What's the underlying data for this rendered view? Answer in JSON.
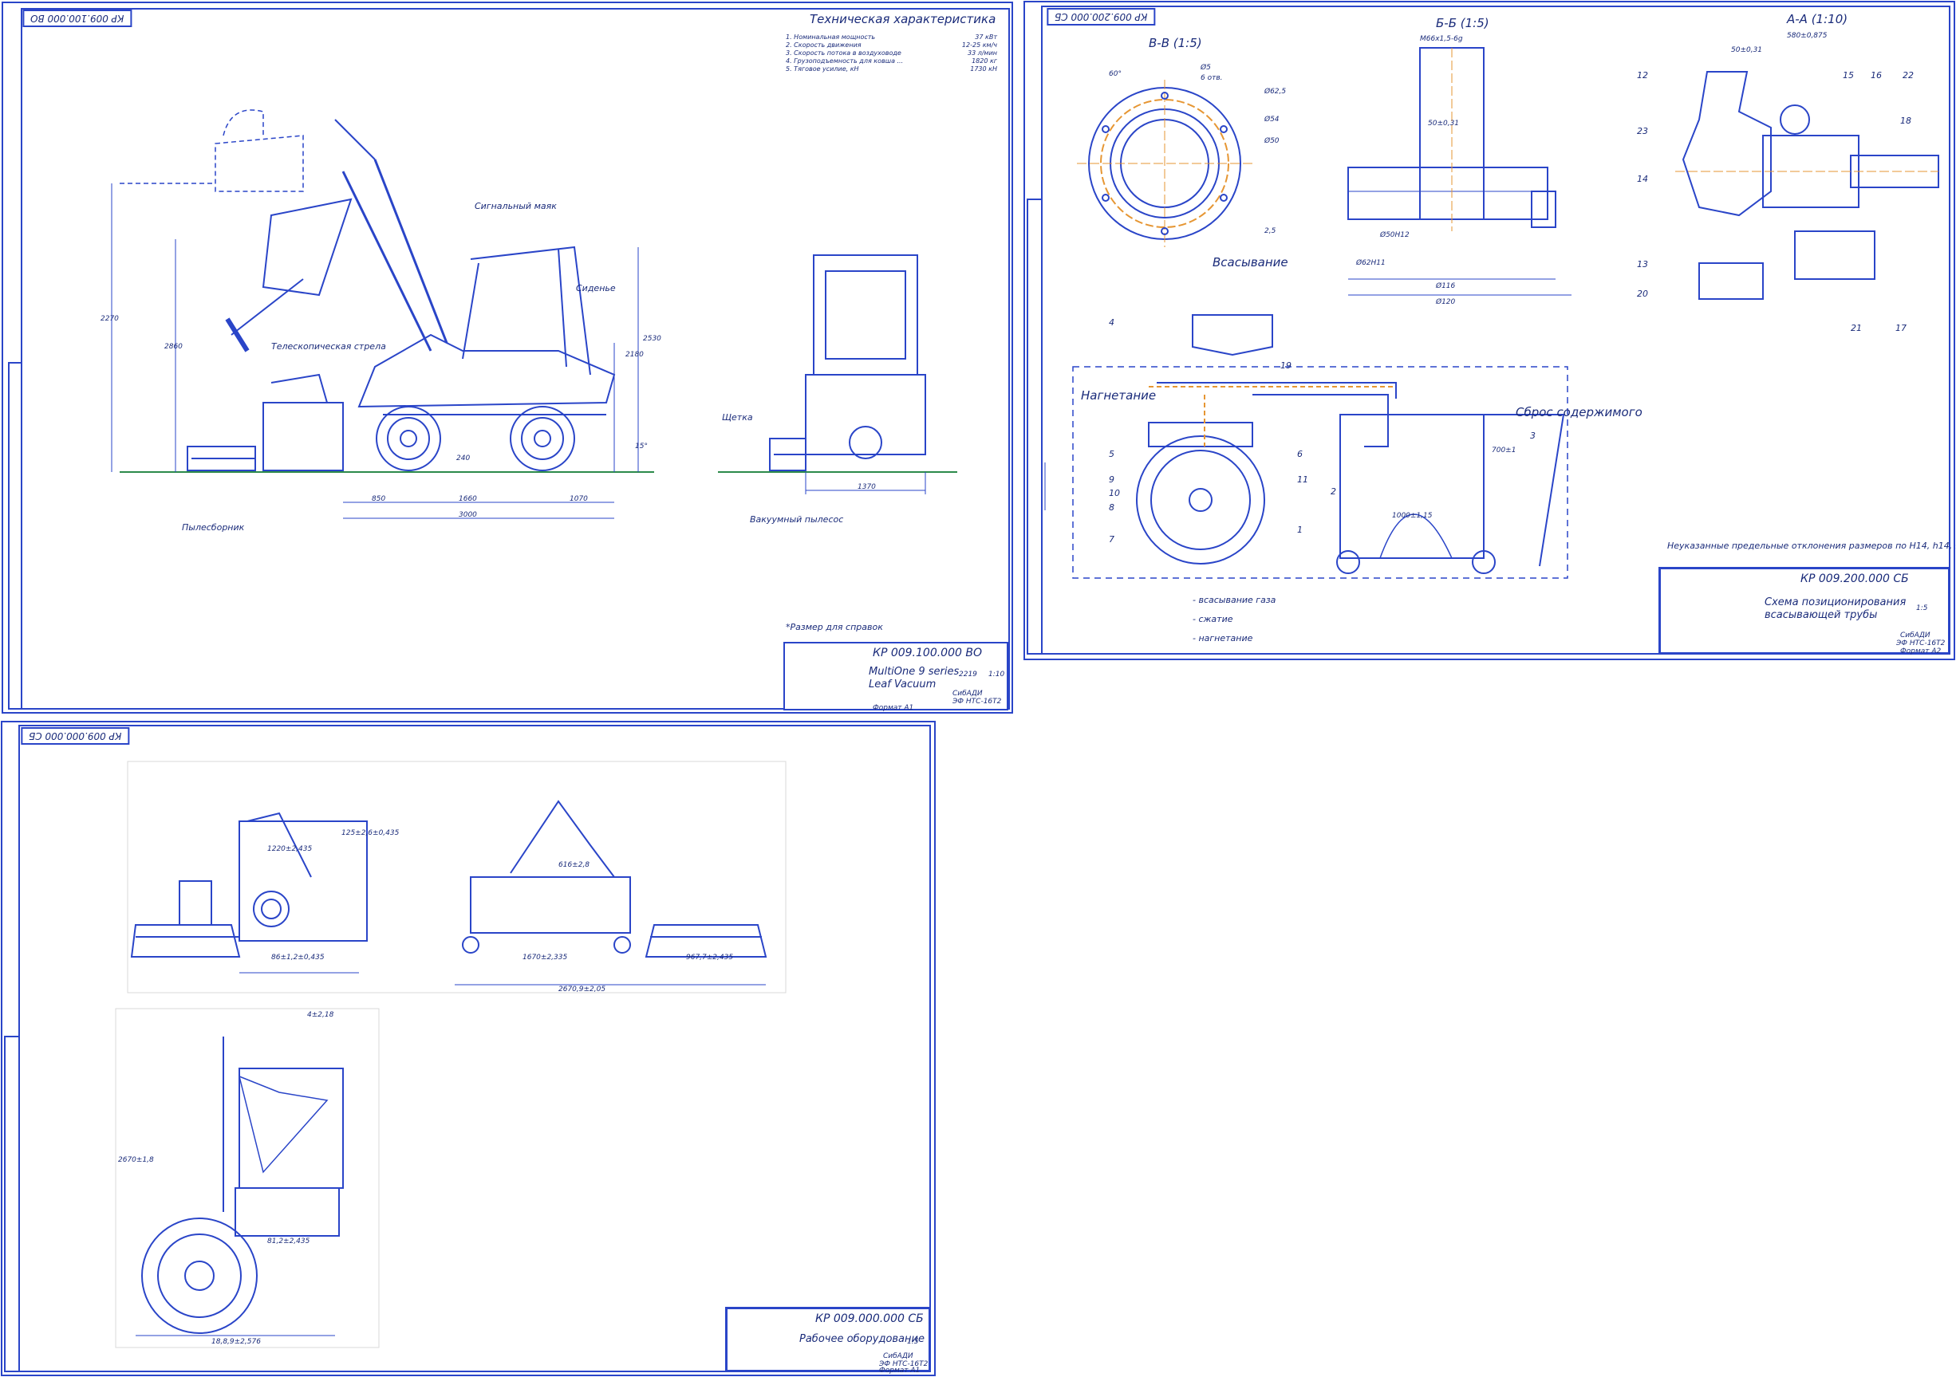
{
  "sheet1": {
    "stamp": "КР 009.100.000 ВО",
    "spec_title": "Техническая характеристика",
    "specs": [
      {
        "label": "1. Номинальная мощность",
        "value": "37 кВт"
      },
      {
        "label": "2. Скорость движения",
        "value": "12-25 км/ч"
      },
      {
        "label": "3. Скорость потока в воздуховоде",
        "value": "33 л/мин"
      },
      {
        "label": "4. Грузоподъемность для ковша ...",
        "value": "1820 кг"
      },
      {
        "label": "5. Тяговое усилие, кН",
        "value": "1730 кН"
      }
    ],
    "labels": {
      "beacon": "Сигнальный маяк",
      "seat": "Сиденье",
      "boom": "Телескопическая стрела",
      "dust": "Пылесборник",
      "brush": "Щетка",
      "pump": "Вакуумный пылесос",
      "note": "*Размер для справок"
    },
    "dims": {
      "d1": "2270",
      "d2": "2860",
      "d3": "2180",
      "d4": "2530",
      "d5": "240",
      "d6": "850",
      "d7": "1660",
      "d8": "1070",
      "d9": "3000",
      "d10": "1370",
      "d11": "15°"
    },
    "title_block": {
      "code": "КР 009.100.000 ВО",
      "title1": "MultiOne 9 series",
      "title2": "Leaf Vacuum",
      "mass": "2219",
      "scale": "1:10",
      "org": "СибАДИ",
      "group": "ЭФ НТС-16Т2",
      "format": "Формат А1"
    }
  },
  "sheet2": {
    "stamp": "КР 009.200.000 СБ",
    "views": {
      "vv": "В-В (1:5)",
      "bb": "Б-Б (1:5)",
      "aa": "А-А (1:10)"
    },
    "labels": {
      "suction": "Всасывание",
      "pressure": "Нагнетание",
      "discharge": "Сброс содержимого",
      "legend1": "- всасывание газа",
      "legend2": "- сжатие",
      "legend3": "- нагнетание",
      "tolerance": "Неуказанные предельные отклонения размеров по Н14, h14, ± IT14/2"
    },
    "leaders": [
      "1",
      "2",
      "3",
      "4",
      "5",
      "6",
      "7",
      "8",
      "9",
      "10",
      "11",
      "12",
      "13",
      "14",
      "15",
      "16",
      "17",
      "18",
      "19",
      "20",
      "21",
      "22",
      "23"
    ],
    "dims": {
      "vv1": "Ø62,5",
      "vv2": "Ø54",
      "vv3": "Ø50",
      "vv4": "Ø5",
      "vv5": "6 отв.",
      "vv6": "60°",
      "vv7": "2,5",
      "bb1": "М66х1,5-6g",
      "bb2": "50±0,31",
      "bb3": "Ø116",
      "bb4": "Ø120",
      "bb5": "Ø62Н11",
      "bb6": "Ø50Н12",
      "aa1": "50±0,31",
      "aa2": "580±0,875",
      "tank": "1000±1,15",
      "tank2": "700±1"
    },
    "title_block": {
      "code": "КР 009.200.000 СБ",
      "title1": "Схема позиционирования",
      "title2": "всасывающей трубы",
      "scale": "1:5",
      "org": "СибАДИ",
      "group": "ЭФ НТС-16Т2",
      "format": "Формат А2"
    }
  },
  "sheet3": {
    "stamp": "КР 009.000.000 СБ",
    "dims": {
      "w1": "86±1,2±0,435",
      "w2": "1220±2,435",
      "w3": "125±2,6±0,435",
      "w4": "2670,9±2,05",
      "w5": "967,7±2,435",
      "w6": "1670±2,335",
      "w7": "18,8,9±2,576",
      "w8": "616±2,8",
      "w9": "81,2±2,435",
      "w10": "2670±1,8",
      "w11": "4±2,18"
    },
    "title_block": {
      "code": "КР 009.000.000 СБ",
      "title1": "Рабочее оборудование",
      "scale": "1:5",
      "org": "СибАДИ",
      "group": "ЭФ НТС-16Т2",
      "format": "Формат А1"
    }
  }
}
